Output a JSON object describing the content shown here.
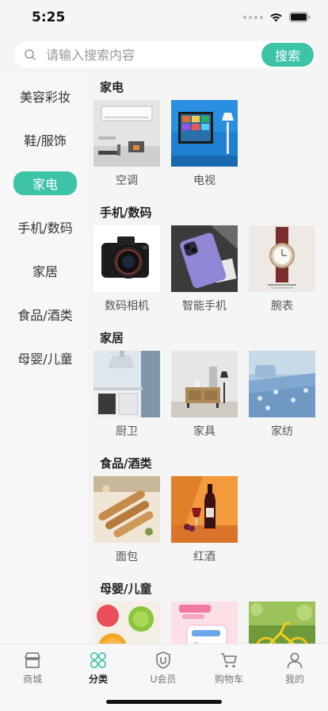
{
  "status_bar": {
    "time": "5:25"
  },
  "search": {
    "placeholder": "请输入搜索内容",
    "button_label": "搜索"
  },
  "sidebar": {
    "items": [
      {
        "label": "美容彩妆"
      },
      {
        "label": "鞋/服饰"
      },
      {
        "label": "家电",
        "active": true
      },
      {
        "label": "手机/数码"
      },
      {
        "label": "家居"
      },
      {
        "label": "食品/酒类"
      },
      {
        "label": "母婴/儿童"
      }
    ]
  },
  "sections": [
    {
      "title": "家电",
      "products": [
        {
          "label": "空调"
        },
        {
          "label": "电视"
        }
      ]
    },
    {
      "title": "手机/数码",
      "products": [
        {
          "label": "数码相机"
        },
        {
          "label": "智能手机"
        },
        {
          "label": "腕表"
        }
      ]
    },
    {
      "title": "家居",
      "products": [
        {
          "label": "厨卫"
        },
        {
          "label": "家具"
        },
        {
          "label": "家纺"
        }
      ]
    },
    {
      "title": "食品/酒类",
      "products": [
        {
          "label": "面包"
        },
        {
          "label": "红酒"
        }
      ]
    },
    {
      "title": "母婴/儿童",
      "products": [
        {
          "label": ""
        },
        {
          "label": ""
        },
        {
          "label": ""
        }
      ]
    }
  ],
  "tabbar": {
    "tabs": [
      {
        "label": "商城",
        "icon": "shop-icon"
      },
      {
        "label": "分类",
        "icon": "category-icon",
        "active": true
      },
      {
        "label": "U会员",
        "icon": "member-icon"
      },
      {
        "label": "购物车",
        "icon": "cart-icon"
      },
      {
        "label": "我的",
        "icon": "profile-icon"
      }
    ]
  },
  "colors": {
    "accent": "#3dc3a6",
    "background": "#f5f5f5"
  }
}
